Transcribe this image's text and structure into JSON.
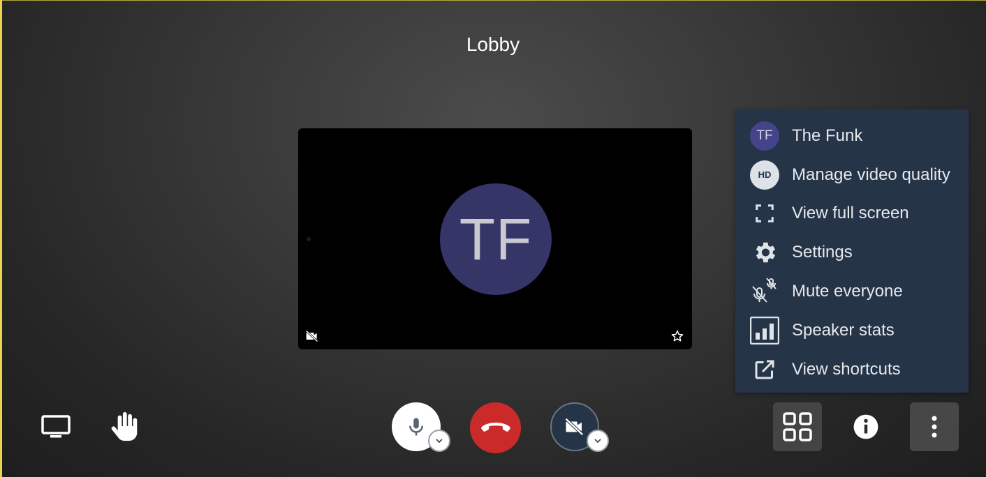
{
  "meeting": {
    "title": "Lobby"
  },
  "participant": {
    "initials": "TF",
    "name": "The Funk"
  },
  "tile": {
    "icons": [
      "camera-off-icon",
      "star-outline-icon"
    ]
  },
  "menu": {
    "items": [
      {
        "label": "The Funk",
        "icon": "avatar",
        "badge": "TF"
      },
      {
        "label": "Manage video quality",
        "icon": "hd-icon",
        "badge": "HD"
      },
      {
        "label": "View full screen",
        "icon": "fullscreen-icon"
      },
      {
        "label": "Settings",
        "icon": "gear-icon"
      },
      {
        "label": "Mute everyone",
        "icon": "mute-everyone-icon"
      },
      {
        "label": "Speaker stats",
        "icon": "bar-chart-icon"
      },
      {
        "label": "View shortcuts",
        "icon": "external-link-icon"
      }
    ]
  },
  "toolbar": {
    "left": [
      "screen-share-icon",
      "raise-hand-icon"
    ],
    "center": [
      "microphone-icon",
      "hang-up-icon",
      "camera-off-icon"
    ],
    "right": [
      "tile-view-icon",
      "info-icon",
      "more-options-icon"
    ]
  },
  "colors": {
    "menu_bg": "#263448",
    "avatar": "#363567",
    "hangup": "#cb2a2a",
    "tile_bg": "#000000"
  }
}
